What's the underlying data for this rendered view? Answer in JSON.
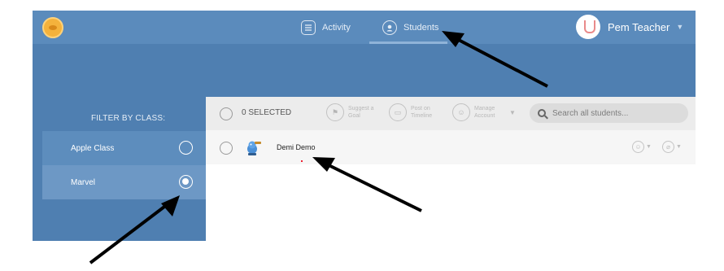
{
  "nav": {
    "activity_label": "Activity",
    "students_label": "Students"
  },
  "user": {
    "name": "Pem Teacher"
  },
  "sidebar": {
    "filter_label": "FILTER BY CLASS:",
    "classes": [
      {
        "label": "Apple Class",
        "selected": false
      },
      {
        "label": "Marvel",
        "selected": true
      }
    ]
  },
  "toolbar": {
    "selected_count": "0 SELECTED",
    "suggest_goal": "Suggest a Goal",
    "post_timeline": "Post on Timeline",
    "manage_account": "Manage Account",
    "search_placeholder": "Search all students..."
  },
  "students": [
    {
      "name": "Demi Demo"
    }
  ],
  "colors": {
    "header": "#5b8bbc",
    "background": "#4f7fb1",
    "toolbar": "#ececec",
    "arrow": "#000000"
  }
}
